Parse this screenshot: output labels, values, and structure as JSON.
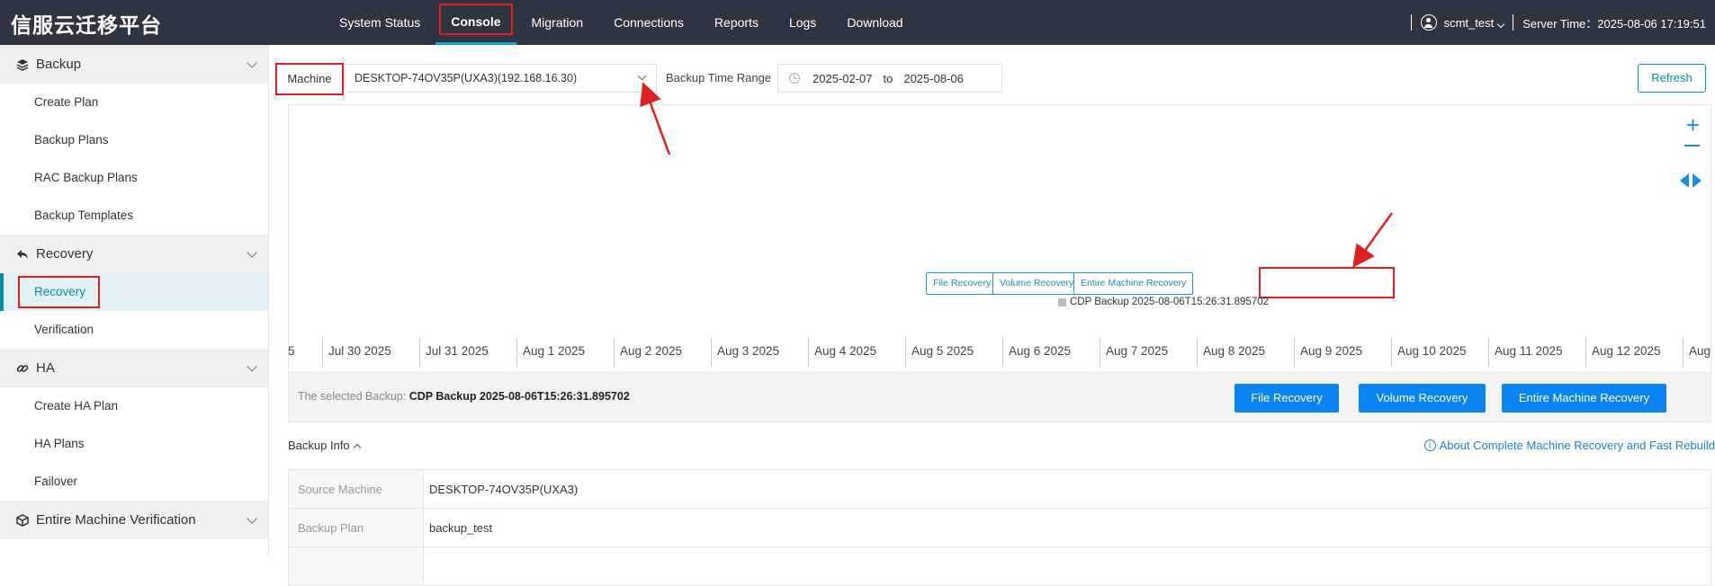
{
  "app": {
    "title": "信服云迁移平台"
  },
  "nav": {
    "items": [
      "System Status",
      "Console",
      "Migration",
      "Connections",
      "Reports",
      "Logs",
      "Download"
    ],
    "active": "Console"
  },
  "user": {
    "name": "scmt_test",
    "server_time": "Server Time：2025-08-06 17:19:51"
  },
  "sidebar": {
    "groups": [
      {
        "label": "Backup",
        "icon": "layers-icon",
        "items": [
          "Create Plan",
          "Backup Plans",
          "RAC Backup Plans",
          "Backup Templates"
        ]
      },
      {
        "label": "Recovery",
        "icon": "reply-icon",
        "items": [
          "Recovery",
          "Verification"
        ]
      },
      {
        "label": "HA",
        "icon": "link-icon",
        "items": [
          "Create HA Plan",
          "HA Plans",
          "Failover"
        ]
      },
      {
        "label": "Entire Machine Verification",
        "icon": "cube-icon",
        "items": []
      }
    ],
    "active_item": "Recovery"
  },
  "filters": {
    "machine_label": "Machine",
    "machine_value": "DESKTOP-74OV35P(UXA3)(192.168.16.30)",
    "range_label": "Backup Time Range",
    "range_from": "2025-02-07",
    "range_to_word": "to",
    "range_to": "2025-08-06",
    "refresh_label": "Refresh"
  },
  "timeline": {
    "first_tick_fragment": "5",
    "ticks": [
      "Jul 30 2025",
      "Jul 31 2025",
      "Aug 1 2025",
      "Aug 2 2025",
      "Aug 3 2025",
      "Aug 4 2025",
      "Aug 5 2025",
      "Aug 6 2025",
      "Aug 7 2025",
      "Aug 8 2025",
      "Aug 9 2025",
      "Aug 10 2025",
      "Aug 11 2025",
      "Aug 12 2025",
      "Aug"
    ],
    "popup_buttons": [
      "File Recovery",
      "Volume Recovery",
      "Entire Machine Recovery"
    ],
    "backup_tag": "CDP Backup 2025-08-06T15:26:31.895702",
    "zoom_in": "+",
    "colors": {
      "accent": "#1a8fd8",
      "tag_swatch": "#bbbbbb"
    }
  },
  "selected": {
    "label": "The selected Backup:",
    "value": "CDP Backup 2025-08-06T15:26:31.895702",
    "buttons": [
      "File Recovery",
      "Volume Recovery",
      "Entire Machine Recovery"
    ]
  },
  "backup_info": {
    "title": "Backup Info",
    "link": "About Complete Machine Recovery and Fast Rebuild",
    "rows": [
      {
        "key": "Source Machine",
        "value": "DESKTOP-74OV35P(UXA3)"
      },
      {
        "key": "Backup Plan",
        "value": "backup_test"
      }
    ]
  },
  "colors": {
    "topbar": "#2f3540",
    "primary_button": "#0a84f0",
    "teal": "#0a8ea8",
    "highlight_box": "#e02020"
  }
}
